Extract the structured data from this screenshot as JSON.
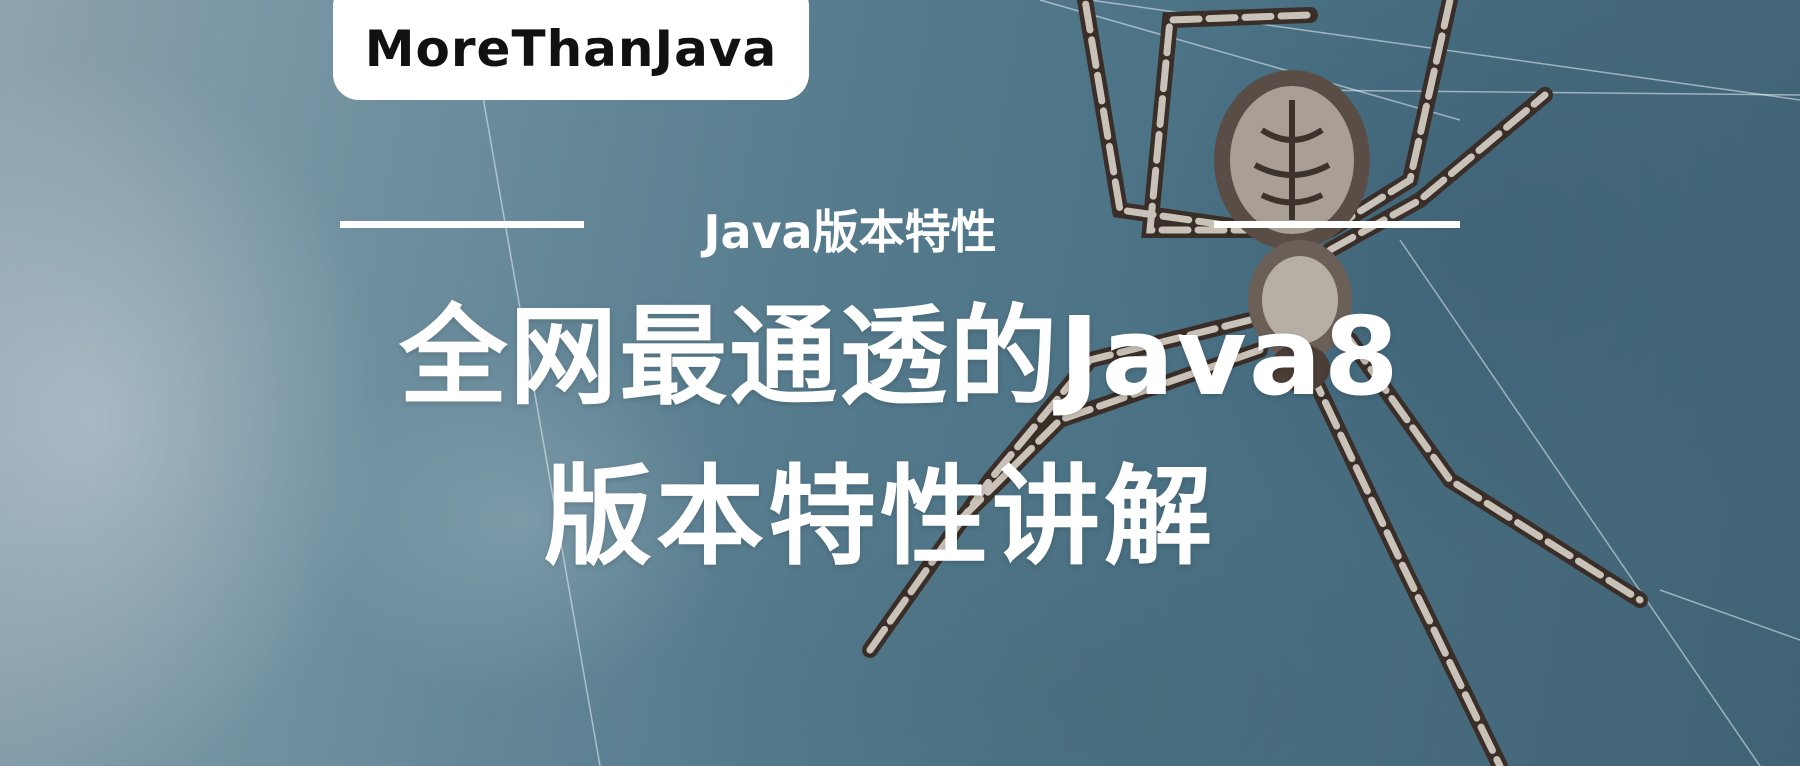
{
  "logo": {
    "text": "MoreThanJava"
  },
  "subtitle": "Java版本特性",
  "title": {
    "line1": "全网最通透的Java8",
    "line2": "版本特性讲解"
  },
  "colors": {
    "background": "#4d7386",
    "text": "#ffffff",
    "logo_bg": "#ffffff",
    "logo_text": "#111111"
  },
  "decor": {
    "background_image": "spider-on-web-icon"
  }
}
